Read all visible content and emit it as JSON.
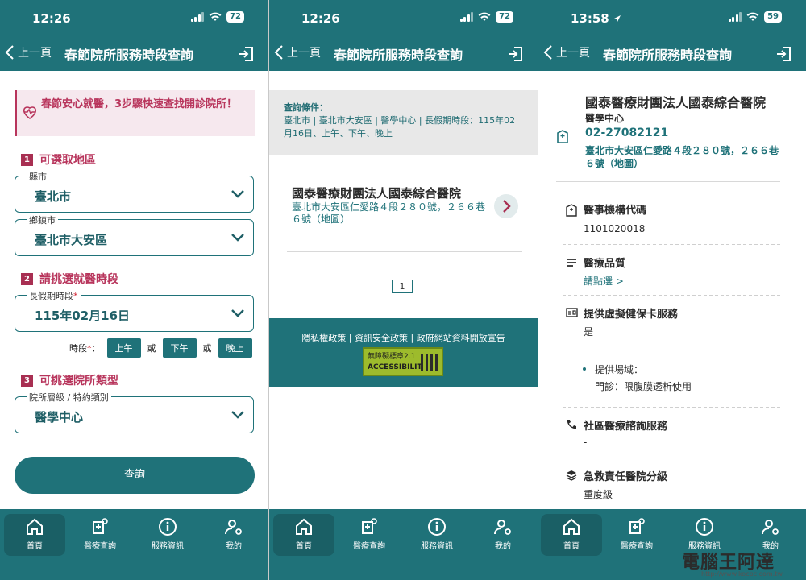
{
  "theme": {
    "primary": "#1f7279",
    "accent": "#b8355c"
  },
  "status": {
    "time1": "12:26",
    "time2": "12:26",
    "time3": "13:58",
    "battery1": "72",
    "battery2": "72",
    "battery3": "59"
  },
  "nav": {
    "back_label": "上一頁",
    "title": "春節院所服務時段查詢"
  },
  "tabs": [
    {
      "label": "首頁",
      "icon": "home-icon"
    },
    {
      "label": "醫療查詢",
      "icon": "medical-search-icon"
    },
    {
      "label": "服務資訊",
      "icon": "info-icon"
    },
    {
      "label": "我的",
      "icon": "user-settings-icon"
    }
  ],
  "search": {
    "banner": "春節安心就醫，3步驟快速查找開診院所！",
    "step1": {
      "num": "1",
      "title": "可選取地區"
    },
    "county": {
      "label": "縣市",
      "value": "臺北市"
    },
    "district": {
      "label": "鄉鎮市",
      "value": "臺北市大安區"
    },
    "step2": {
      "num": "2",
      "title": "請挑選就醫時段"
    },
    "date": {
      "label": "長假期時段",
      "required": "*",
      "value": "115年02月16日"
    },
    "period_label": "時段",
    "periods": [
      "上午",
      "下午",
      "晚上"
    ],
    "or": "或",
    "step3": {
      "num": "3",
      "title": "可挑選院所類型"
    },
    "type": {
      "label": "院所層級 / 特約類別",
      "value": "醫學中心"
    },
    "submit": "查詢"
  },
  "results": {
    "cond_title": "查詢條件：",
    "cond_text": "臺北市 | 臺北市大安區 | 醫學中心 | 長假期時段：115年02月16日、上午、下午、晚上",
    "hospital_name": "國泰醫療財團法人國泰綜合醫院",
    "hospital_addr": "臺北市大安區仁愛路４段２８０號，２６６巷６號（地圖）",
    "page": "1",
    "footer_links": "隱私權政策 | 資訊安全政策 | 政府網站資料開放宣告",
    "badge_top": "無障礙標章2.1",
    "badge_bottom": "ACCESSIBILITY"
  },
  "detail": {
    "name": "國泰醫療財團法人國泰綜合醫院",
    "type": "醫學中心",
    "phone": "02-27082121",
    "address": "臺北市大安區仁愛路４段２８０號，２６６巷６號（地圖）",
    "code_label": "醫事機構代碼",
    "code_value": "1101020018",
    "quality_label": "醫療品質",
    "quality_link": "請點選 >",
    "virtual_label": "提供虛擬健保卡服務",
    "virtual_value": "是",
    "venue_label": "提供場域：",
    "venue_value": "門診：限腹膜透析使用",
    "community_label": "社區醫療諮詢服務",
    "community_value": "-",
    "emergency_label": "急救責任醫院分級",
    "emergency_value": "重度級"
  },
  "watermark": {
    "text": "電腦王阿達",
    "url": "http://www.kocpc.com.tw"
  }
}
